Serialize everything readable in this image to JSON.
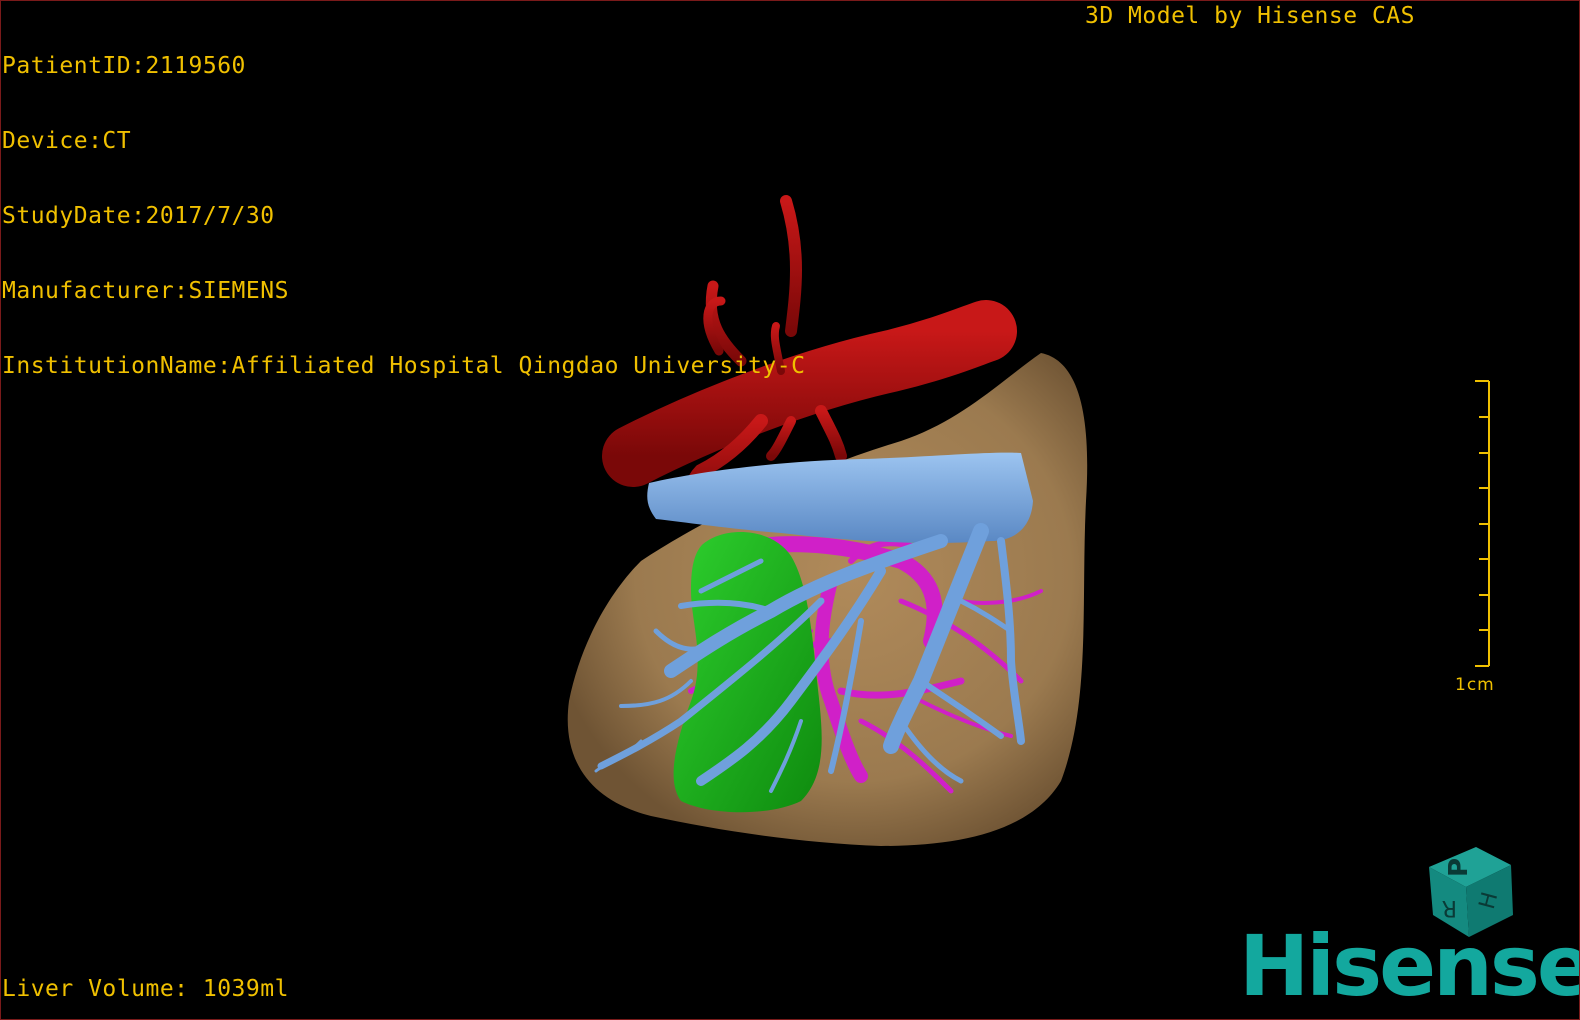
{
  "patient_info": {
    "patient_id": "PatientID:2119560",
    "device": "Device:CT",
    "study_date": "StudyDate:2017/7/30",
    "manufacturer": "Manufacturer:SIEMENS",
    "institution": "InstitutionName:Affiliated Hospital Qingdao University-C"
  },
  "model_credit": "3D Model by Hisense CAS",
  "liver_volume": "Liver Volume: 1039ml",
  "scale_bar": {
    "label": "1cm"
  },
  "orientation_cube": {
    "face_labels": [
      "P",
      "H",
      "R"
    ]
  },
  "brand": "Hisense",
  "colors": {
    "overlay_text": "#f0c000",
    "background": "#000000",
    "liver": "#9b7a4f",
    "artery": "#a81010",
    "portal_vein": "#6fa0dc",
    "hepatic_vein": "#d020c8",
    "gallbladder": "#1fb21f",
    "brand": "#13a89e"
  }
}
